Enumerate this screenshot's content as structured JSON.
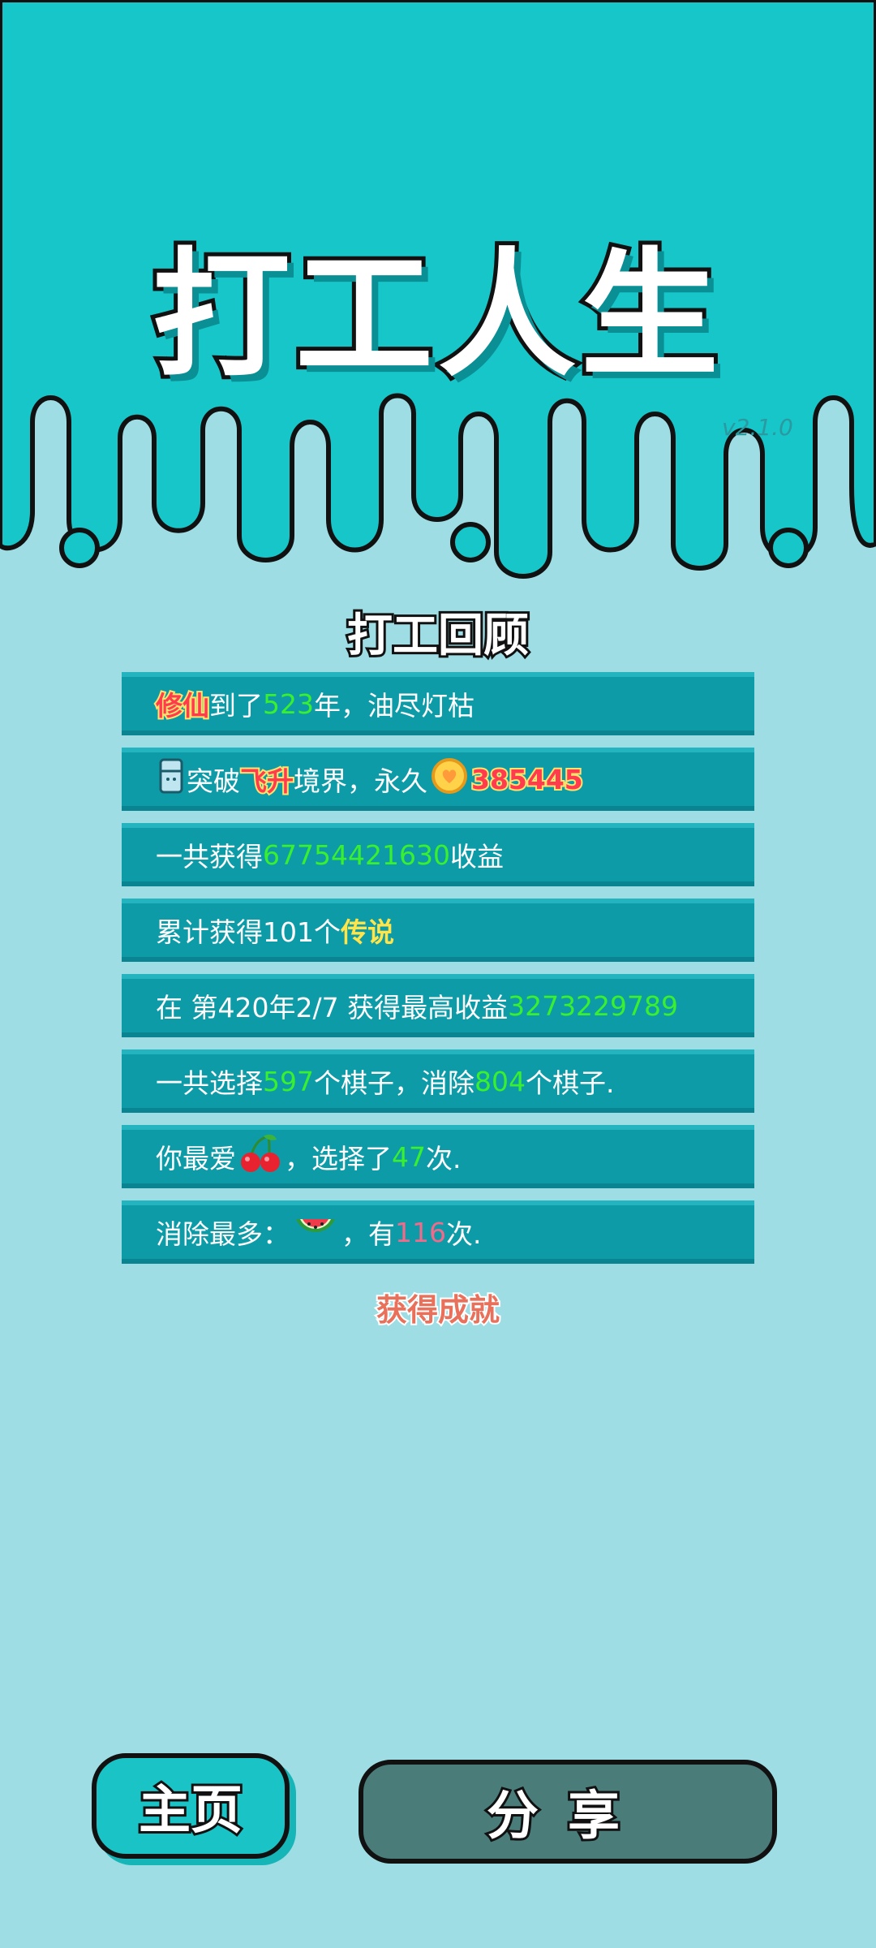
{
  "header": {
    "game_title": "打工人生",
    "version": "v2.1.0"
  },
  "section_title": "打工回顾",
  "rows": [
    {
      "a": "修仙",
      "b": "到了",
      "c": "523",
      "d": "年，油尽灯枯"
    },
    {
      "icon": "fridge-icon",
      "a": "突破",
      "b": "飞升",
      "c": "境界，永久",
      "coin_icon": "coin-heart-icon",
      "d": "385445"
    },
    {
      "a": "一共获得",
      "b": "67754421630",
      "c": "收益"
    },
    {
      "a": "累计获得101个",
      "b": "传说"
    },
    {
      "a": "在 第420年2/7 获得最高收益",
      "b": "3273229789"
    },
    {
      "a": "一共选择",
      "b": "597",
      "c": "个棋子，消除",
      "d": "804",
      "e": "个棋子."
    },
    {
      "a": "你最爱",
      "icon": "cherry-icon",
      "b": "，选择了",
      "c": "47",
      "d": "次."
    },
    {
      "a": "消除最多：",
      "icon": "watermelon-icon",
      "b": "，有",
      "c": "116",
      "d": "次."
    }
  ],
  "achievements_label": "获得成就",
  "buttons": {
    "home": "主页",
    "share": "分享"
  },
  "colors": {
    "top_bg": "#16c6c9",
    "bottom_bg": "#9fdde5",
    "row_bg": "#0e9ba8",
    "highlight_green": "#39f02e",
    "highlight_red": "#ff3b4e",
    "share_button": "#4a7d7a"
  }
}
